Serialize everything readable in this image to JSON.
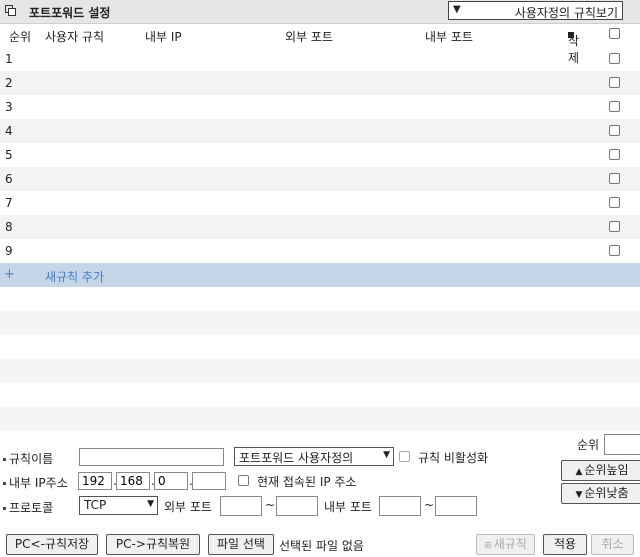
{
  "header": {
    "title": "포트포워드 설정",
    "view_select": "사용자정의 규칙보기"
  },
  "columns": {
    "order": "순위",
    "rule": "사용자 규칙",
    "internal_ip": "내부 IP",
    "external_port": "외부 포트",
    "internal_port": "내부 포트",
    "delete": "삭제"
  },
  "rows": [
    {
      "n": "1"
    },
    {
      "n": "2"
    },
    {
      "n": "3"
    },
    {
      "n": "4"
    },
    {
      "n": "5"
    },
    {
      "n": "6"
    },
    {
      "n": "7"
    },
    {
      "n": "8"
    },
    {
      "n": "9"
    }
  ],
  "add_rule": {
    "icon": "+",
    "label": "새규칙 추가"
  },
  "form": {
    "rule_name_label": "규칙이름",
    "rule_name_value": "",
    "rule_type": "포트포워드 사용자정의",
    "disable_label": "규칙 비활성화",
    "ip_label": "내부 IP주소",
    "ip": [
      "192",
      "168",
      "0",
      ""
    ],
    "current_ip_label": "현재 접속된 IP 주소",
    "protocol_label": "프로토콜",
    "protocol": "TCP",
    "ext_port_label": "외부 포트",
    "int_port_label": "내부 포트",
    "tilde": "~",
    "rank_label": "순위",
    "rank_value": "",
    "rank_up": "순위높임",
    "rank_down": "순위낮춤"
  },
  "buttons": {
    "save_to_pc": "PC<-규칙저장",
    "restore_from_pc": "PC->규칙복원",
    "choose_file": "파일 선택",
    "no_file": "선택된 파일 없음",
    "new_rule": "새규칙",
    "apply": "적용",
    "cancel": "취소"
  }
}
